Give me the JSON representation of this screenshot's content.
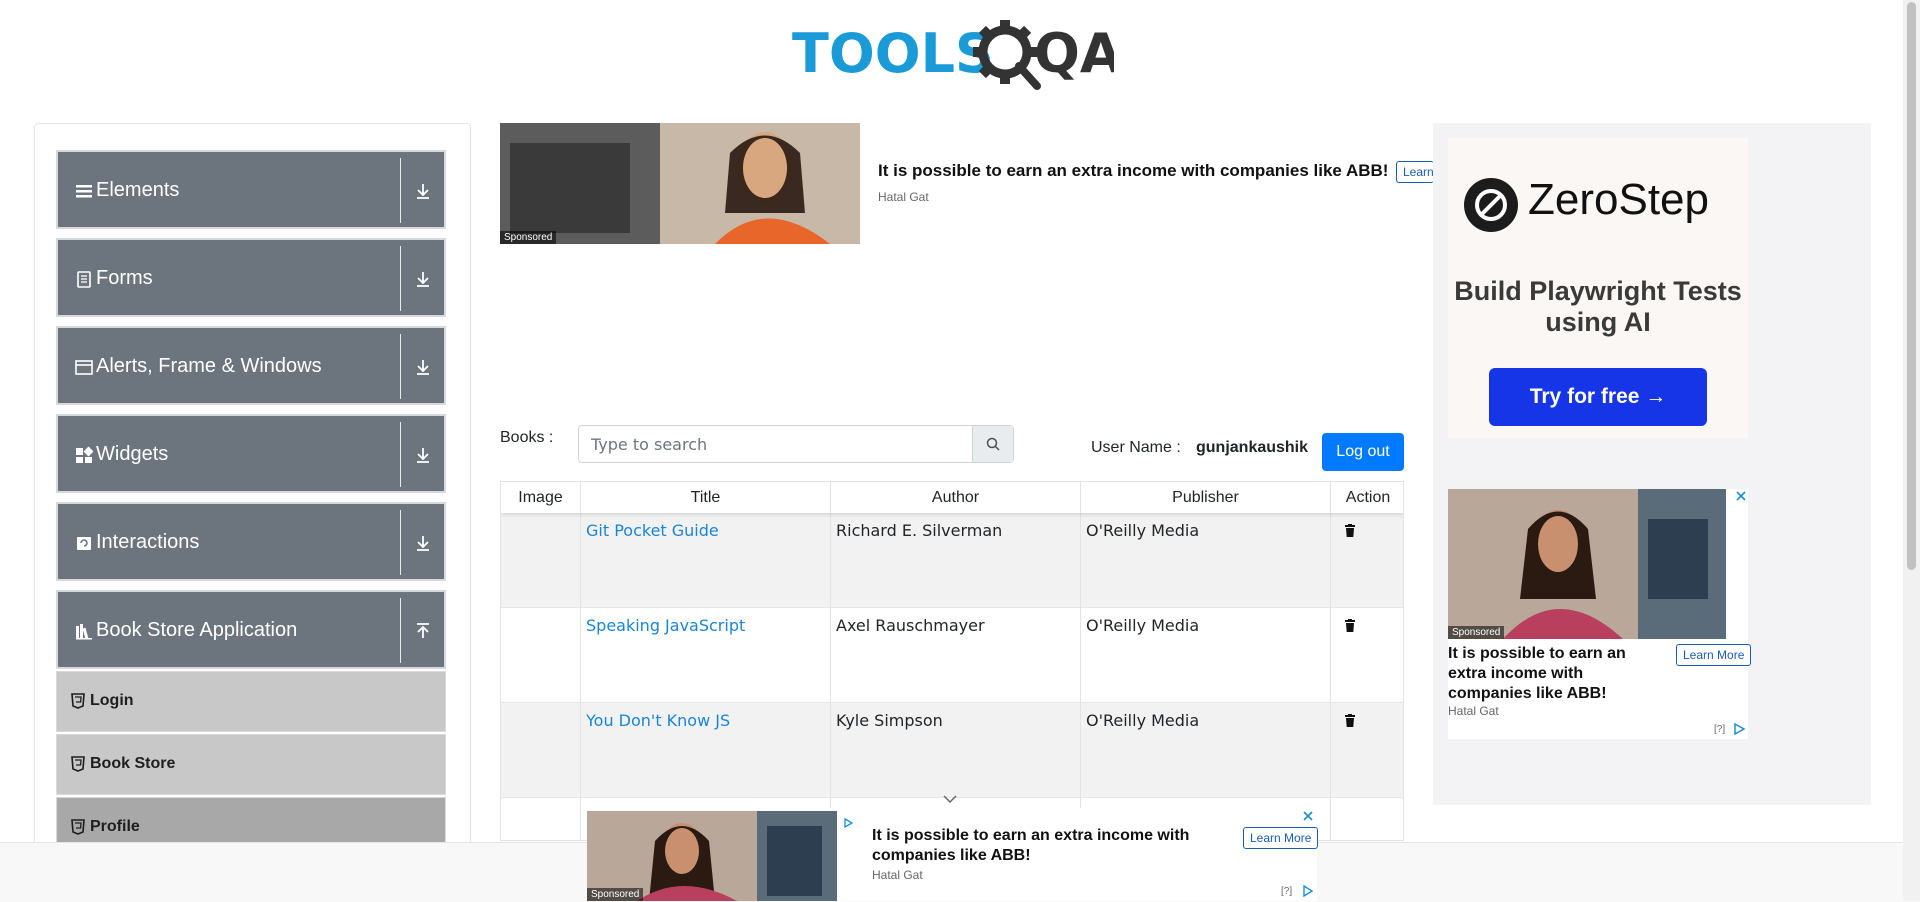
{
  "logo": {
    "text_tools": "TOOLS",
    "text_qa": "QA"
  },
  "sidebar": {
    "groups": [
      {
        "label": "Elements",
        "icon": "hamburger-icon",
        "arrow": "download-arrow-icon"
      },
      {
        "label": "Forms",
        "icon": "form-icon",
        "arrow": "download-arrow-icon"
      },
      {
        "label": "Alerts, Frame & Windows",
        "icon": "window-icon",
        "arrow": "download-arrow-icon"
      },
      {
        "label": "Widgets",
        "icon": "widgets-icon",
        "arrow": "download-arrow-icon"
      },
      {
        "label": "Interactions",
        "icon": "interactions-icon",
        "arrow": "download-arrow-icon"
      },
      {
        "label": "Book Store Application",
        "icon": "books-icon",
        "arrow": "upload-arrow-icon"
      }
    ],
    "subitems": [
      {
        "label": "Login",
        "active": false
      },
      {
        "label": "Book Store",
        "active": false
      },
      {
        "label": "Profile",
        "active": true
      }
    ]
  },
  "ad_top": {
    "headline": "It is possible to earn an extra income with companies like ABB!",
    "source": "Hatal Gat",
    "sponsored": "Sponsored",
    "learn": "Learn"
  },
  "ad_right": {
    "brand": "ZeroStep",
    "subtitle": "Build Playwright Tests using AI",
    "button": "Try for free →",
    "second": {
      "headline": "It is possible to earn an extra income with companies like ABB!",
      "source": "Hatal Gat",
      "sponsored": "Sponsored",
      "learn": "Learn More",
      "info": "[?]"
    }
  },
  "ad_bottom": {
    "headline": "It is possible to earn an extra income with companies like ABB!",
    "source": "Hatal Gat",
    "sponsored": "Sponsored",
    "learn": "Learn More",
    "info": "[?]"
  },
  "books": {
    "label": "Books :",
    "search_placeholder": "Type to search",
    "user_label": "User Name :",
    "user_value": "gunjankaushik",
    "logout": "Log out",
    "columns": [
      "Image",
      "Title",
      "Author",
      "Publisher",
      "Action"
    ],
    "rows": [
      {
        "title": "Git Pocket Guide",
        "author": "Richard E. Silverman",
        "publisher": "O'Reilly Media"
      },
      {
        "title": "Speaking JavaScript",
        "author": "Axel Rauschmayer",
        "publisher": "O'Reilly Media"
      },
      {
        "title": "You Don't Know JS",
        "author": "Kyle Simpson",
        "publisher": "O'Reilly Media"
      }
    ]
  },
  "colors": {
    "sidebar_group": "#6c757d",
    "sidebar_sub": "#c8c8c8",
    "link": "#1a85d8",
    "primary_button": "#007bff",
    "zerostep_button": "#1535e6",
    "logo_blue": "#1a9ad6"
  }
}
